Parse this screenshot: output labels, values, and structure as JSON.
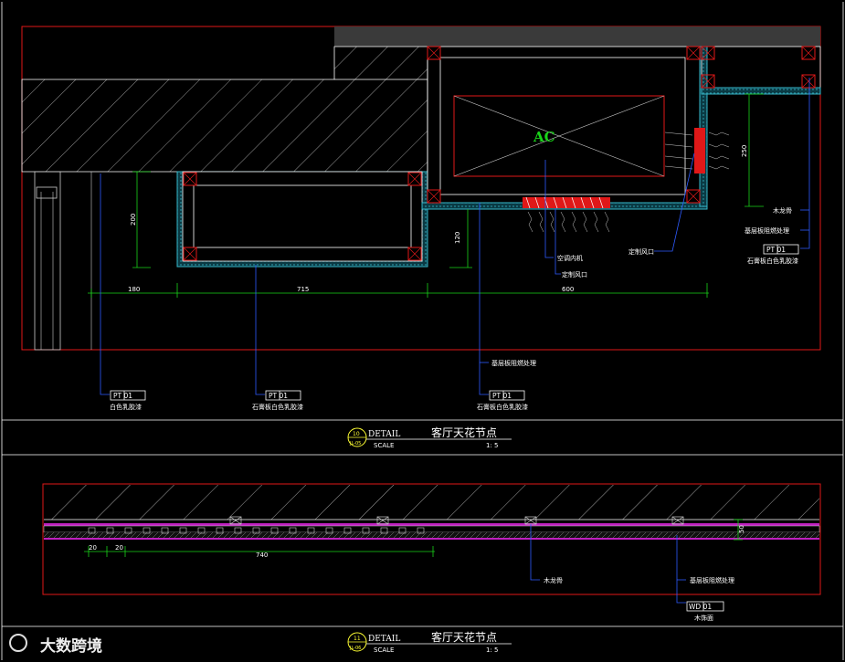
{
  "detail10": {
    "dims": {
      "d180": "180",
      "d715": "715",
      "d600": "600",
      "d200": "200",
      "d120": "120",
      "d250": "250"
    },
    "ac_label": "AC",
    "notes": {
      "ac_unit": "空调内机",
      "outlet_bottom": "定制风口",
      "outlet_side": "定制风口",
      "keel_right": "木龙骨",
      "fireproof_right": "基层板阻燃处理",
      "fireproof_bottom": "基层板阻燃处理"
    },
    "tags": {
      "left": {
        "code": "PT  01",
        "desc": "白色乳胶漆"
      },
      "middle": {
        "code": "PT  01",
        "desc": "石膏板白色乳胶漆"
      },
      "bottom_right": {
        "code": "PT  01",
        "desc": "石膏板白色乳胶漆"
      },
      "right": {
        "code": "PT  01",
        "desc": "石膏板白色乳胶漆"
      }
    },
    "title": {
      "num": "10",
      "sheet": "JL-05",
      "detail": "DETAIL",
      "name": "客厅天花节点",
      "scale_label": "SCALE",
      "scale": "1:  5"
    }
  },
  "detail11": {
    "dims": {
      "d20a": "20",
      "d20b": "20",
      "d740": "740",
      "d50": "50"
    },
    "notes": {
      "keel": "木龙骨",
      "fireproof": "基层板阻燃处理"
    },
    "tag": {
      "code": "WD  01",
      "desc": "木饰面"
    },
    "title": {
      "num": "11",
      "sheet": "JL-06",
      "detail": "DETAIL",
      "name": "客厅天花节点",
      "scale_label": "SCALE",
      "scale": "1:  5"
    }
  },
  "watermark": "大数跨境",
  "colors": {
    "red": "#e01818",
    "cyan": "#36b6c8",
    "blue": "#2e5bff",
    "yellow": "#ffff33",
    "green": "#19d319",
    "magenta": "#c020c0"
  }
}
